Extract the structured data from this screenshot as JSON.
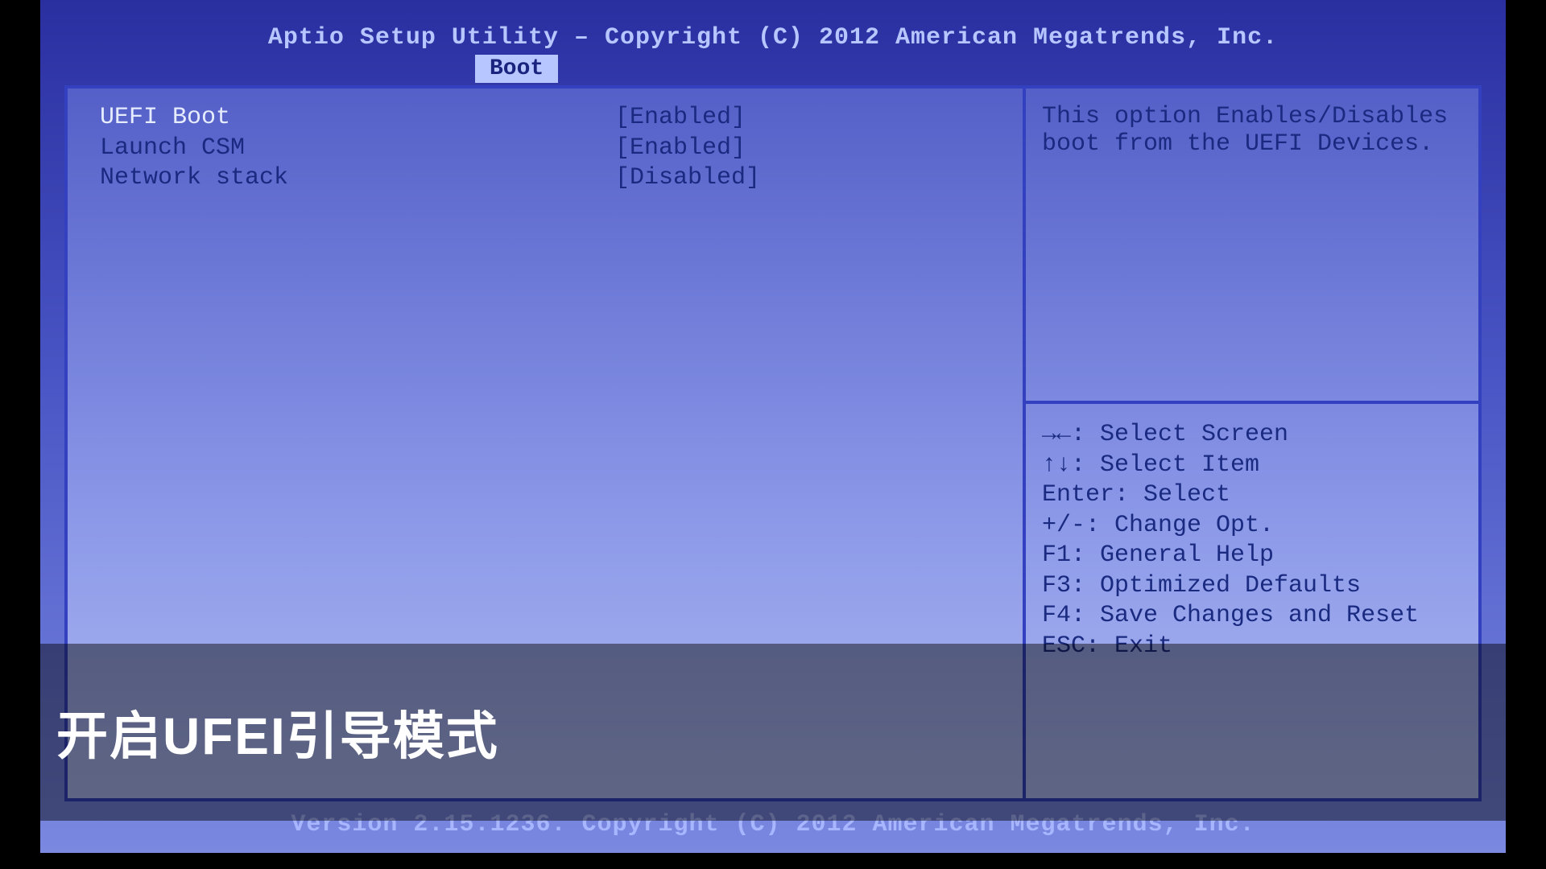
{
  "header": {
    "title": "Aptio Setup Utility – Copyright (C) 2012 American Megatrends, Inc."
  },
  "tabs": {
    "active": "Boot"
  },
  "options": [
    {
      "label": "UEFI Boot",
      "value": "[Enabled]",
      "selected": true
    },
    {
      "label": "Launch CSM",
      "value": "[Enabled]",
      "selected": false
    },
    {
      "label": "",
      "value": "",
      "selected": false
    },
    {
      "label": "Network stack",
      "value": "[Disabled]",
      "selected": false
    }
  ],
  "help": {
    "line1": "This option Enables/Disables",
    "line2": "boot from the UEFI Devices."
  },
  "keys": [
    "→←: Select Screen",
    "↑↓: Select Item",
    "Enter: Select",
    "+/-: Change Opt.",
    "F1: General Help",
    "F3: Optimized Defaults",
    "F4: Save Changes and Reset",
    "ESC: Exit"
  ],
  "footer": {
    "version": "Version 2.15.1236. Copyright (C) 2012 American Megatrends, Inc."
  },
  "caption": "开启UFEI引导模式"
}
